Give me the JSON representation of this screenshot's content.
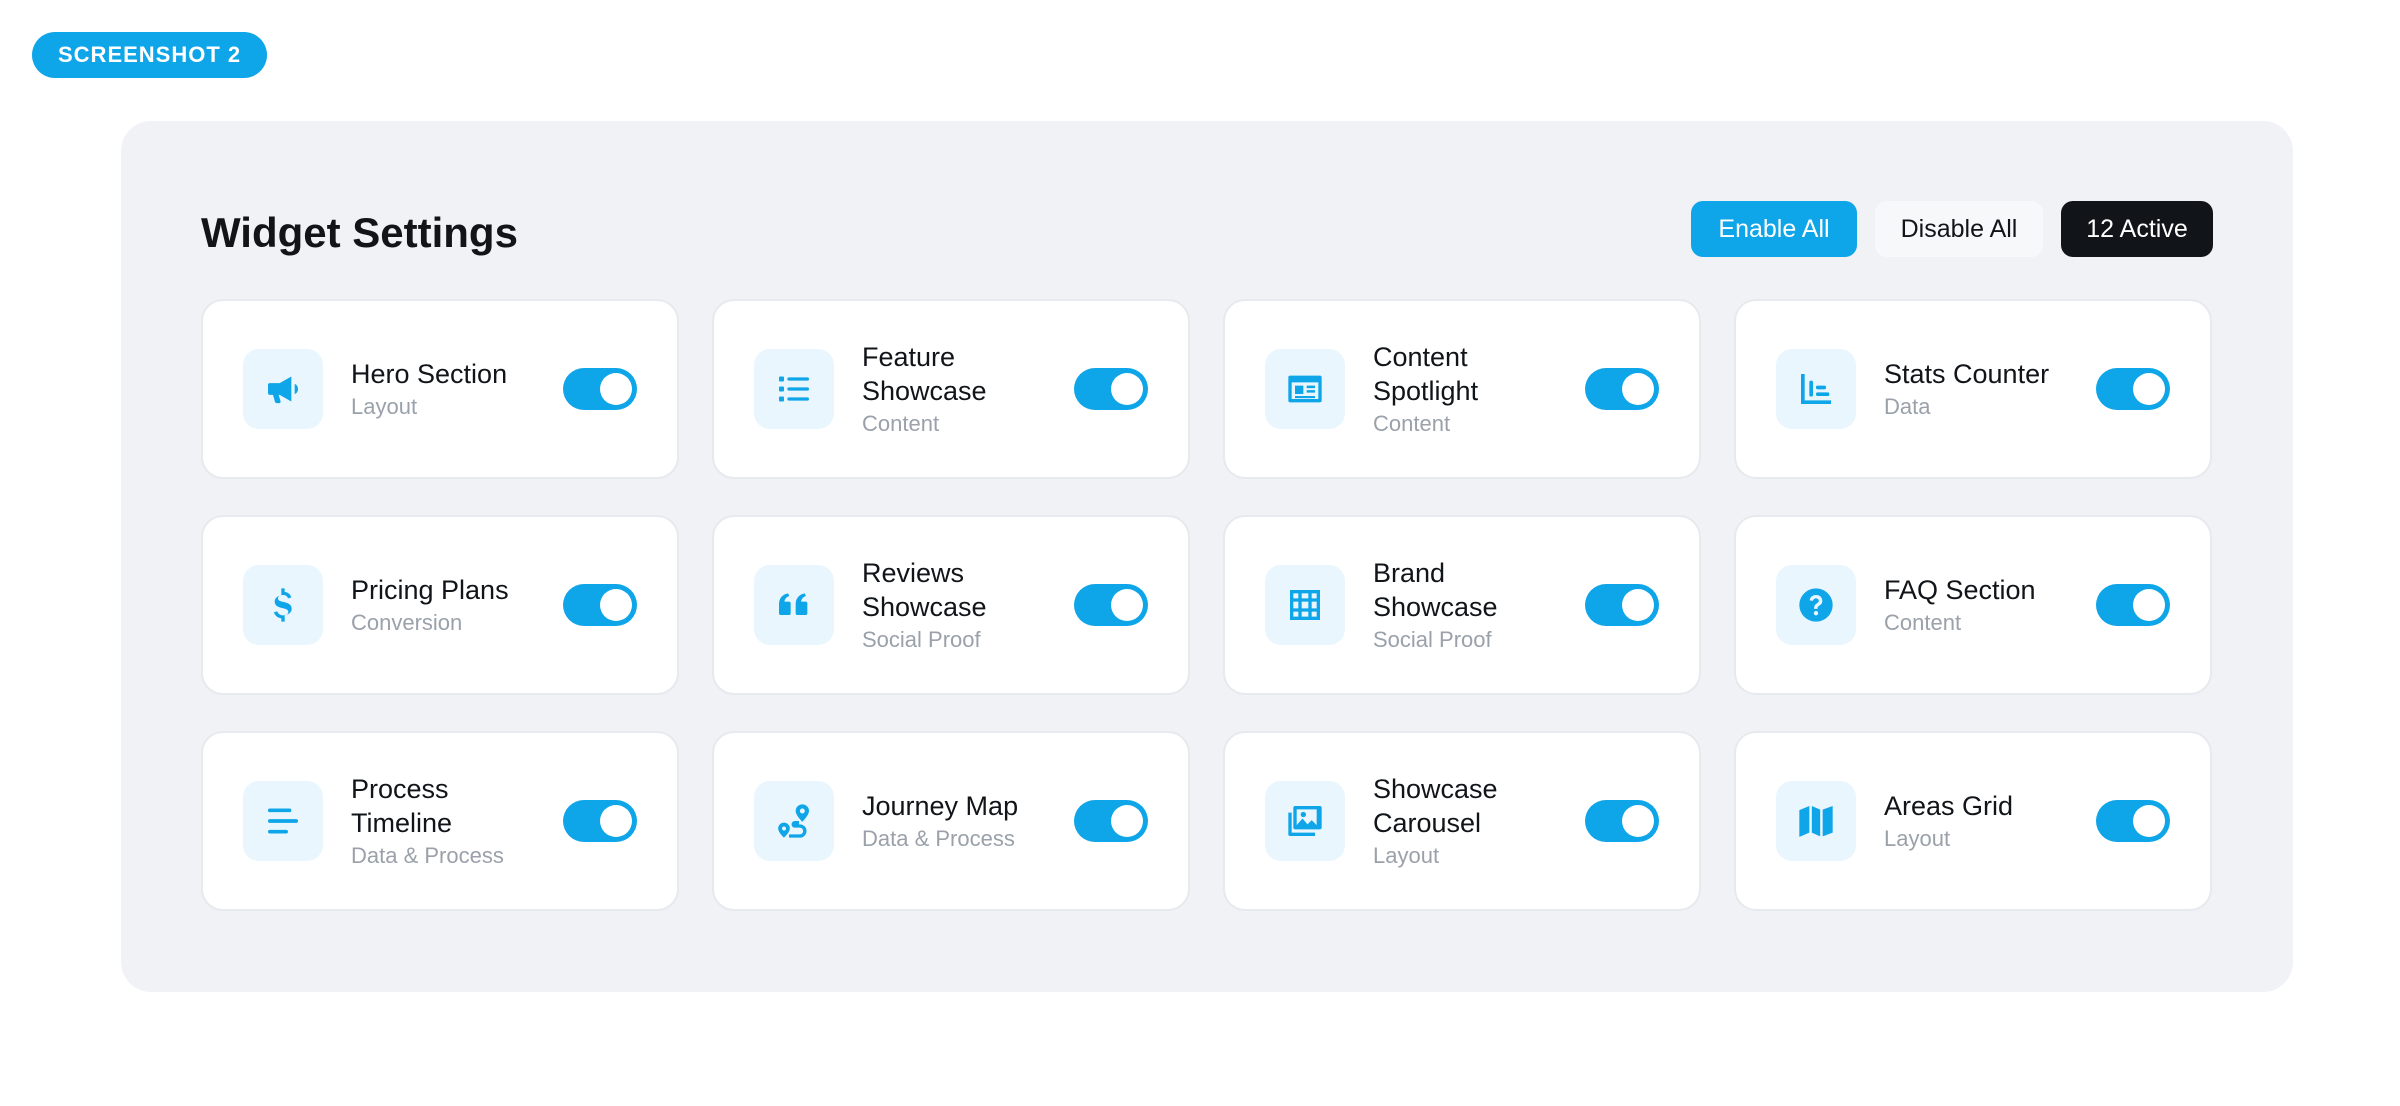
{
  "badge": "SCREENSHOT 2",
  "panel": {
    "title": "Widget Settings",
    "actions": {
      "enable_all": "Enable All",
      "disable_all": "Disable All",
      "active_count": "12 Active"
    }
  },
  "colors": {
    "accent": "#0ea5e9",
    "dark": "#111418",
    "panel_bg": "#f0f2f5"
  },
  "widgets": [
    {
      "name": "Hero Section",
      "category": "Layout",
      "icon": "megaphone-icon",
      "enabled": true
    },
    {
      "name": "Feature Showcase",
      "category": "Content",
      "icon": "list-icon",
      "enabled": true
    },
    {
      "name": "Content Spotlight",
      "category": "Content",
      "icon": "id-card-icon",
      "enabled": true
    },
    {
      "name": "Stats Counter",
      "category": "Data",
      "icon": "bar-chart-icon",
      "enabled": true
    },
    {
      "name": "Pricing Plans",
      "category": "Conversion",
      "icon": "dollar-icon",
      "enabled": true
    },
    {
      "name": "Reviews Showcase",
      "category": "Social Proof",
      "icon": "quote-icon",
      "enabled": true
    },
    {
      "name": "Brand Showcase",
      "category": "Social Proof",
      "icon": "grid-icon",
      "enabled": true
    },
    {
      "name": "FAQ Section",
      "category": "Content",
      "icon": "question-icon",
      "enabled": true
    },
    {
      "name": "Process Timeline",
      "category": "Data & Process",
      "icon": "align-lines-icon",
      "enabled": true
    },
    {
      "name": "Journey Map",
      "category": "Data & Process",
      "icon": "route-icon",
      "enabled": true
    },
    {
      "name": "Showcase Carousel",
      "category": "Layout",
      "icon": "images-icon",
      "enabled": true
    },
    {
      "name": "Areas Grid",
      "category": "Layout",
      "icon": "map-icon",
      "enabled": true
    }
  ]
}
